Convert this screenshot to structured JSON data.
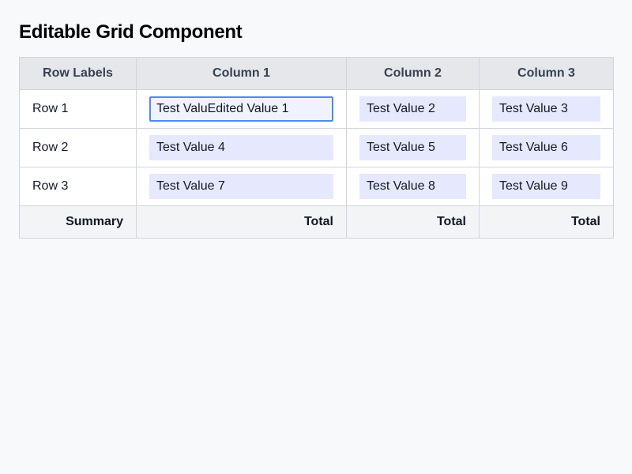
{
  "page": {
    "title": "Editable Grid Component"
  },
  "grid": {
    "headers": [
      "Row Labels",
      "Column 1",
      "Column 2",
      "Column 3"
    ],
    "rows": [
      {
        "label": "Row 1",
        "cells": [
          "Test ValuEdited Value 1",
          "Test Value 2",
          "Test Value 3"
        ],
        "active_cell": 0
      },
      {
        "label": "Row 2",
        "cells": [
          "Test Value 4",
          "Test Value 5",
          "Test Value 6"
        ]
      },
      {
        "label": "Row 3",
        "cells": [
          "Test Value 7",
          "Test Value 8",
          "Test Value 9"
        ]
      }
    ],
    "footer": {
      "label": "Summary",
      "totals": [
        "Total",
        "Total",
        "Total"
      ]
    }
  },
  "colors": {
    "page_background": "#f8f9fb",
    "header_background": "#e5e7eb",
    "footer_background": "#f3f4f6",
    "cell_fill": "#e6e8fd",
    "active_border": "#4a8af4",
    "grid_border": "#d1d5db"
  }
}
